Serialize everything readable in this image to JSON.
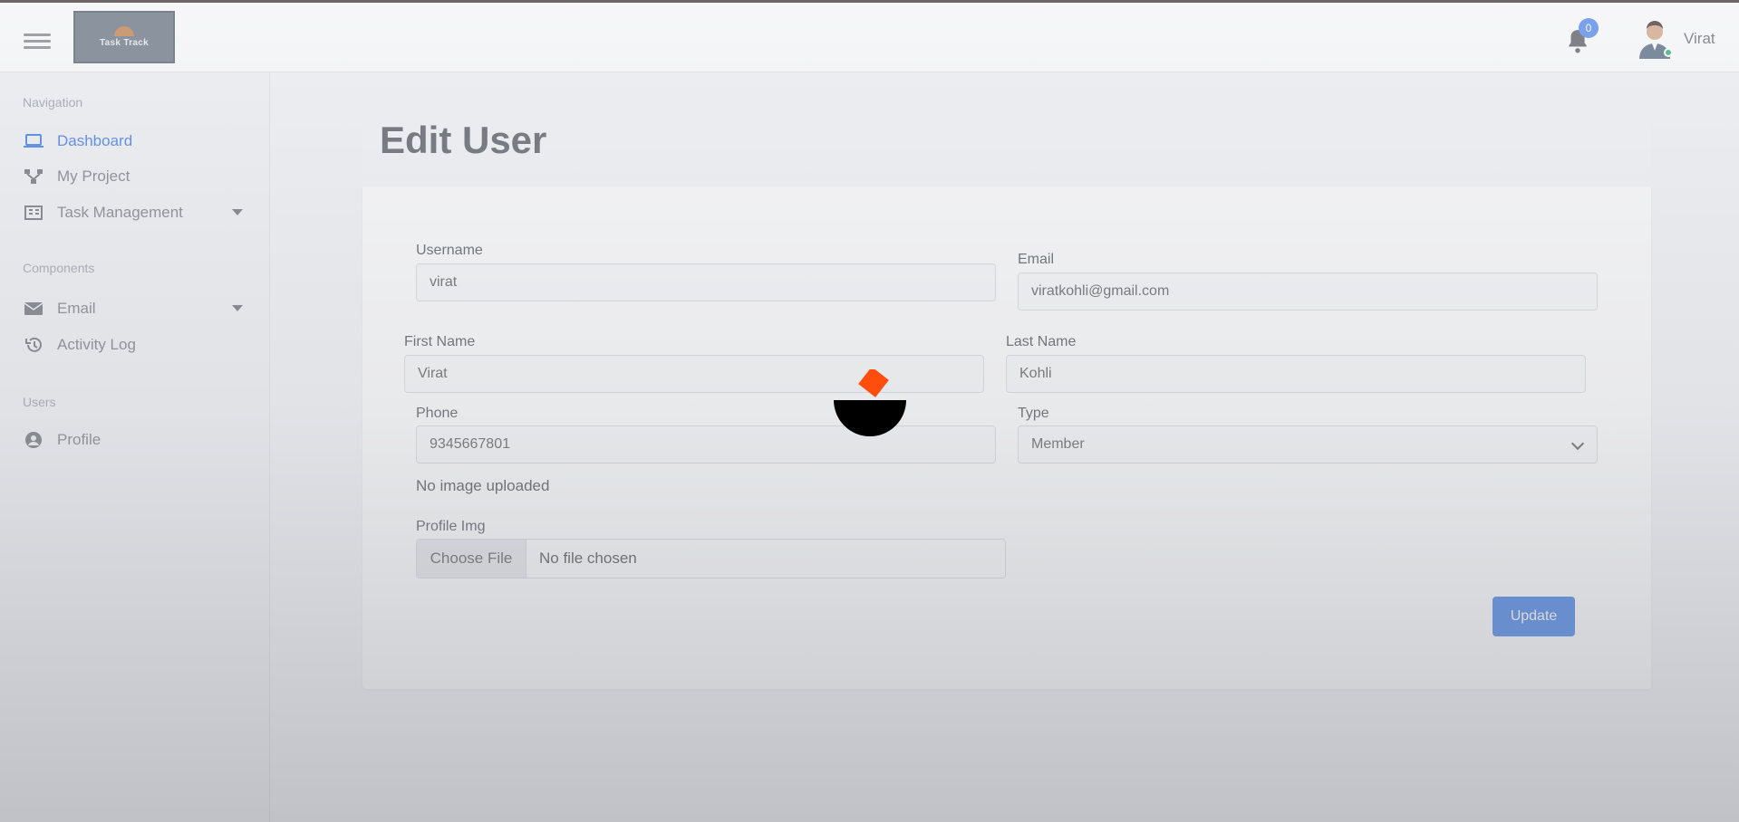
{
  "navbar": {
    "logo_text": "Task Track",
    "notification_count": "0",
    "user_name": "Virat"
  },
  "sidebar": {
    "sections": [
      {
        "title": "Navigation",
        "items": [
          {
            "label": "Dashboard",
            "icon": "laptop-icon",
            "active": true
          },
          {
            "label": "My Project",
            "icon": "project-network-icon"
          },
          {
            "label": "Task Management",
            "icon": "task-list-icon",
            "has_submenu": true
          }
        ]
      },
      {
        "title": "Components",
        "items": [
          {
            "label": "Email",
            "icon": "envelope-icon",
            "has_submenu": true
          },
          {
            "label": "Activity Log",
            "icon": "history-icon"
          }
        ]
      },
      {
        "title": "Users",
        "items": [
          {
            "label": "Profile",
            "icon": "user-circle-icon"
          }
        ]
      }
    ]
  },
  "page": {
    "title": "Edit User"
  },
  "form": {
    "username_label": "Username",
    "username_value": "virat",
    "email_label": "Email",
    "email_value": "viratkohli@gmail.com",
    "first_name_label": "First Name",
    "first_name_value": "Virat",
    "last_name_label": "Last Name",
    "last_name_value": "Kohli",
    "phone_label": "Phone",
    "phone_value": "9345667801",
    "type_label": "Type",
    "type_value": "Member",
    "no_image_text": "No image uploaded",
    "profile_img_label": "Profile Img",
    "choose_file_label": "Choose File",
    "file_status": "No file chosen",
    "update_label": "Update"
  },
  "colors": {
    "accent": "#3779e8",
    "loader_orange": "#ff4d0d",
    "loader_black": "#000000"
  }
}
